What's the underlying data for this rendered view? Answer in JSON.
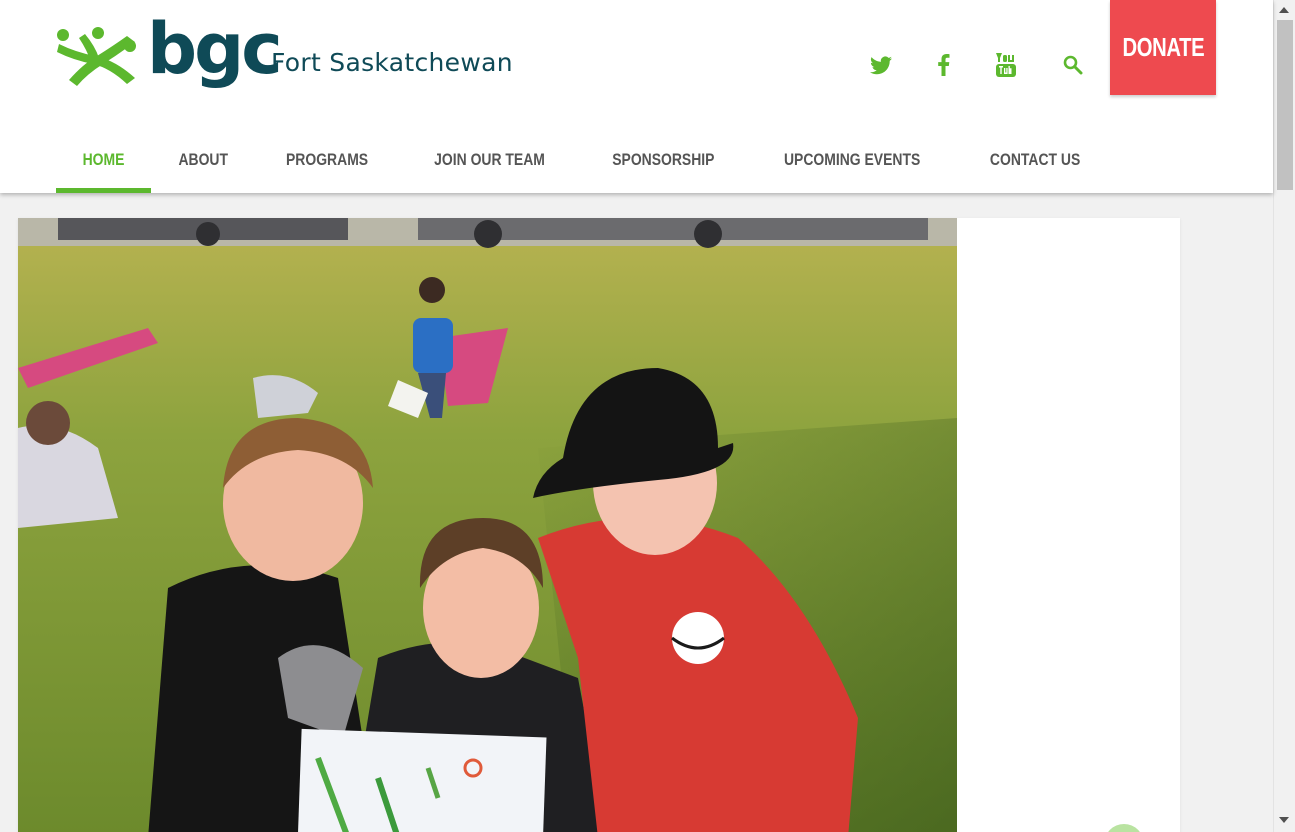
{
  "header": {
    "logo_text": "bgc",
    "site_name": "Fort Saskatchewan",
    "donate_label": "DONATE",
    "social": [
      {
        "icon": "twitter-icon"
      },
      {
        "icon": "facebook-icon"
      },
      {
        "icon": "youtube-icon"
      },
      {
        "icon": "search-icon"
      }
    ]
  },
  "nav": {
    "items": [
      {
        "label": "HOME",
        "active": true
      },
      {
        "label": "ABOUT"
      },
      {
        "label": "PROGRAMS"
      },
      {
        "label": "JOIN OUR TEAM"
      },
      {
        "label": "SPONSORSHIP"
      },
      {
        "label": "UPCOMING EVENTS"
      },
      {
        "label": "CONTACT US"
      }
    ]
  },
  "colors": {
    "brand_green": "#5cb82e",
    "brand_teal": "#0f4a57",
    "donate_red": "#ee4a4f"
  }
}
